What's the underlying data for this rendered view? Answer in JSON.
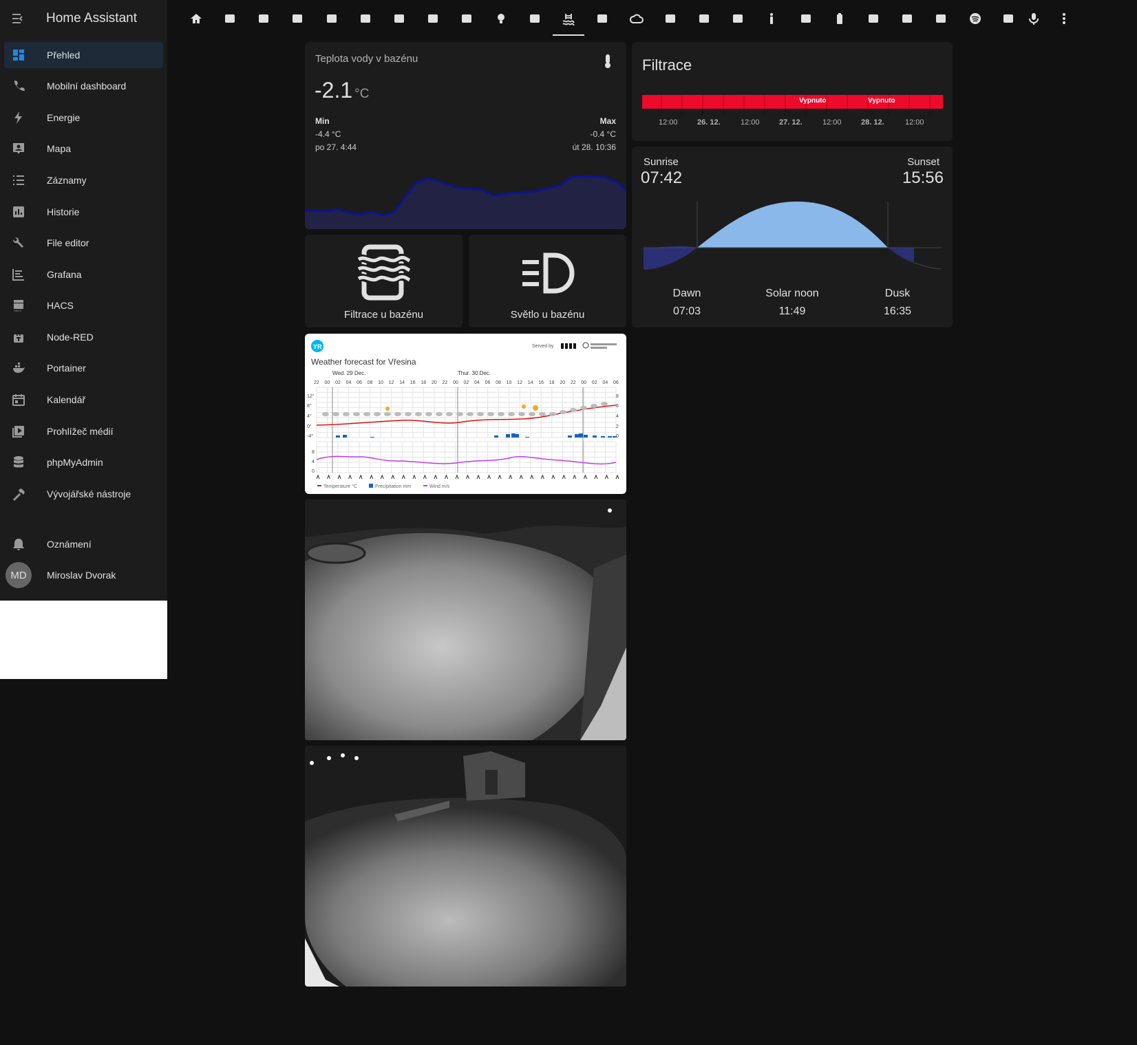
{
  "app": {
    "title": "Home Assistant"
  },
  "sidebar": {
    "items": [
      {
        "label": "Přehled",
        "icon": "dashboard-icon",
        "active": true
      },
      {
        "label": "Mobilní dashboard",
        "icon": "phone-icon"
      },
      {
        "label": "Energie",
        "icon": "lightning-icon"
      },
      {
        "label": "Mapa",
        "icon": "map-account-icon"
      },
      {
        "label": "Záznamy",
        "icon": "list-icon"
      },
      {
        "label": "Historie",
        "icon": "chart-box-icon"
      },
      {
        "label": "File editor",
        "icon": "wrench-icon"
      },
      {
        "label": "Grafana",
        "icon": "chart-timeline-icon"
      },
      {
        "label": "HACS",
        "icon": "hacs-icon"
      },
      {
        "label": "Node-RED",
        "icon": "sitemap-icon"
      },
      {
        "label": "Portainer",
        "icon": "docker-icon"
      },
      {
        "label": "Kalendář",
        "icon": "calendar-icon"
      },
      {
        "label": "Prohlížeč médií",
        "icon": "play-box-icon"
      },
      {
        "label": "phpMyAdmin",
        "icon": "database-icon"
      },
      {
        "label": "Vývojářské nástroje",
        "icon": "hammer-icon"
      }
    ],
    "notifications": {
      "label": "Oznámení",
      "icon": "bell-icon"
    },
    "user": {
      "initials": "MD",
      "name": "Miroslav Dvorak"
    }
  },
  "tabs": [
    "home-icon",
    "sofa-icon",
    "monitor-icon",
    "family-icon",
    "folder-music-icon",
    "bed-icon",
    "stairs-icon",
    "school-icon",
    "washing-machine-icon",
    "lightbulb-icon",
    "car-icon",
    "pool-icon",
    "heat-pump-icon",
    "cloud-icon",
    "fan-ac-icon",
    "cube-icon",
    "desk-icon",
    "human-icon",
    "printer-icon",
    "battery-icon",
    "cctv-icon",
    "home-roof-icon",
    "motion-icon",
    "spotify-icon",
    "clipboard-grid-icon",
    "microphone-icon",
    "more-vertical-icon"
  ],
  "pool_temp": {
    "title": "Teplota vody v bazénu",
    "value": "-2.1",
    "unit": "°C",
    "min_label": "Min",
    "min_value": "-4.4 °C",
    "min_time": "po 27. 4:44",
    "max_label": "Max",
    "max_value": "-0.4 °C",
    "max_time": "út 28. 10:36",
    "history": [
      -3.9,
      -4.0,
      -4.0,
      -3.8,
      -4.2,
      -4.3,
      -4.1,
      -4.4,
      -4.2,
      -2.6,
      -1.1,
      -0.6,
      -0.9,
      -1.3,
      -1.6,
      -1.7,
      -1.8,
      -2.4,
      -2.2,
      -2.1,
      -2.0,
      -1.9,
      -1.6,
      -1.3,
      -0.5,
      -0.4,
      -0.4,
      -0.5,
      -0.9,
      -1.8
    ]
  },
  "buttons": {
    "filtration": "Filtrace u bazénu",
    "light": "Světlo u bazénu"
  },
  "filtrace": {
    "title": "Filtrace",
    "state_labels": [
      "Vypnuto",
      "Vypnuto"
    ],
    "ticks": [
      "12:00",
      "26. 12.",
      "12:00",
      "27. 12.",
      "12:00",
      "28. 12.",
      "12:00"
    ],
    "bar_color": "#ee0a2a"
  },
  "sun": {
    "sunrise_label": "Sunrise",
    "sunrise": "07:42",
    "sunset_label": "Sunset",
    "sunset": "15:56",
    "dawn_label": "Dawn",
    "dawn": "07:03",
    "noon_label": "Solar noon",
    "noon": "11:49",
    "dusk_label": "Dusk",
    "dusk": "16:35"
  },
  "weather": {
    "title": "Weather forecast for Vřesina",
    "served_by": "Served by",
    "day1": "Wed. 29 Dec.",
    "day2": "Thur. 30 Dec.",
    "hours": [
      "22",
      "00",
      "02",
      "04",
      "06",
      "08",
      "10",
      "12",
      "14",
      "16",
      "18",
      "20",
      "22",
      "00",
      "02",
      "04",
      "06",
      "08",
      "10",
      "12",
      "14",
      "16",
      "18",
      "20",
      "22",
      "00",
      "02",
      "04",
      "06"
    ],
    "legend_temp": "Temperature °C",
    "legend_precip": "Precipitation mm",
    "legend_wind": "Wind m/s"
  }
}
